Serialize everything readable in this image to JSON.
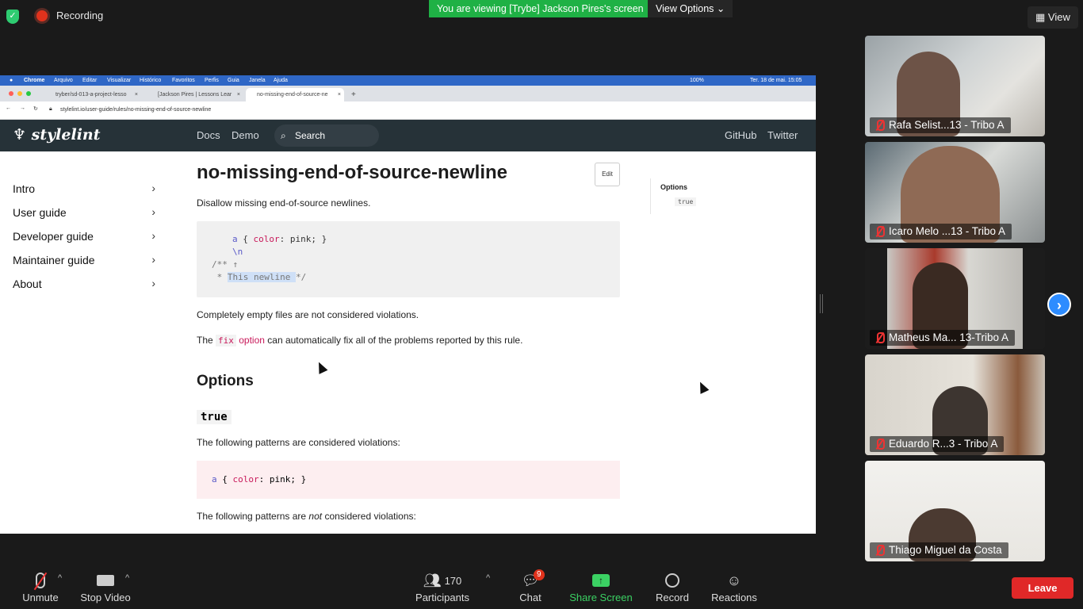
{
  "zoom": {
    "recording_label": "Recording",
    "viewing_banner": "You are viewing [Trybe] Jackson Pires's screen",
    "view_options_label": "View Options",
    "view_label": "View",
    "next_page_icon": "chevron-right-icon",
    "participants": [
      {
        "name": "Rafa Selist...13 - Tribo A",
        "muted": true
      },
      {
        "name": "Icaro Melo ...13 - Tribo A",
        "muted": true
      },
      {
        "name": "Matheus Ma... 13-Tribo A",
        "muted": true
      },
      {
        "name": "Eduardo  R...3 - Tribo A",
        "muted": true
      },
      {
        "name": "Thiago Miguel da Costa",
        "muted": true
      }
    ],
    "toolbar": {
      "unmute": "Unmute",
      "stop_video": "Stop Video",
      "participants": "Participants",
      "participants_count": "170",
      "chat": "Chat",
      "chat_badge": "9",
      "share_screen": "Share Screen",
      "record": "Record",
      "reactions": "Reactions",
      "leave": "Leave"
    }
  },
  "mac_menu": {
    "app": "Chrome",
    "items": [
      "Arquivo",
      "Editar",
      "Visualizar",
      "Histórico",
      "Favoritos",
      "Perfis",
      "Guia",
      "Janela",
      "Ajuda"
    ],
    "battery": "100%",
    "datetime": "Ter. 18 de mai.  15:05"
  },
  "browser": {
    "tabs": [
      {
        "title": "tryber/sd-013-a-project-lesso",
        "active": false
      },
      {
        "title": "[Jackson Pires | Lessons Lear",
        "active": false
      },
      {
        "title": "no-missing-end-of-source-ne",
        "active": true
      }
    ],
    "new_tab": "+",
    "url": "stylelint.io/user-guide/rules/no-missing-end-of-source-newline"
  },
  "site": {
    "logo": "stylelint",
    "nav": [
      "Docs",
      "Demo"
    ],
    "search_label": "Search",
    "right_nav": [
      "GitHub",
      "Twitter"
    ],
    "sidebar": [
      "Intro",
      "User guide",
      "Developer guide",
      "Maintainer guide",
      "About"
    ],
    "title": "no-missing-end-of-source-newline",
    "edit": "Edit",
    "description": "Disallow missing end-of-source newlines.",
    "code_example": {
      "line1_sel": "a",
      "line1_open": " { ",
      "line1_prop": "color",
      "line1_rest": ": pink; }",
      "line2": "\\n",
      "line3": "/** ↑",
      "line4_prefix": " * ",
      "line4_highlight": "This newline ",
      "line4_suffix": "*/"
    },
    "empty_files_note": "Completely empty files are not considered violations.",
    "fix_prefix": "The ",
    "fix_code": "fix",
    "fix_link": "option",
    "fix_suffix": " can automatically fix all of the problems reported by this rule.",
    "options_heading": "Options",
    "option_true": "true",
    "violations_intro": "The following patterns are considered violations:",
    "violation_code": {
      "sel": "a",
      "open": " { ",
      "prop": "color",
      "rest": ": pink; }"
    },
    "not_violations_prefix": "The following patterns are ",
    "not_violations_em": "not",
    "not_violations_suffix": " considered violations:",
    "toc_title": "Options",
    "toc_item": "true"
  }
}
